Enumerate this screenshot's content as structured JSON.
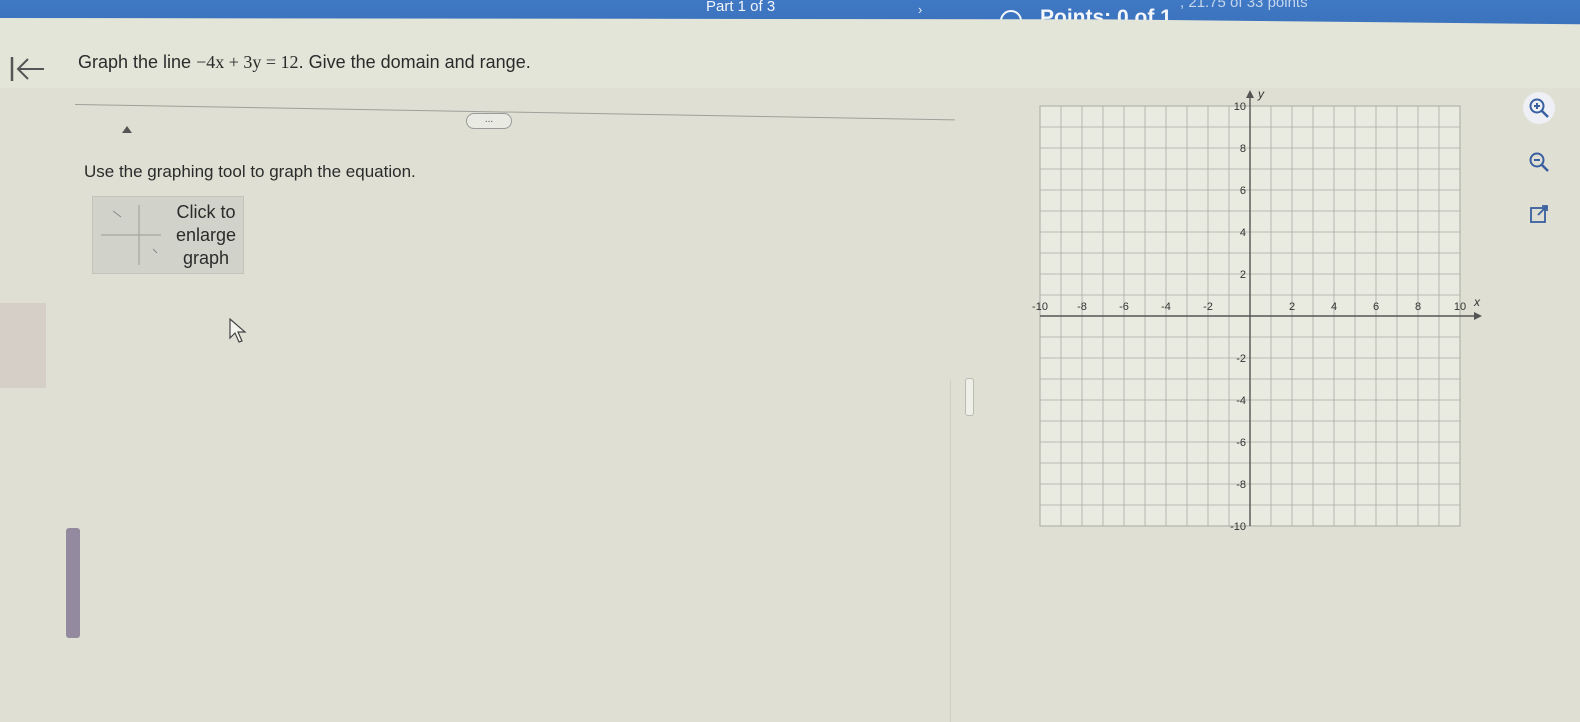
{
  "header": {
    "part": "Part 1 of 3",
    "score_partial": ", 21.75 of 33 points",
    "points": "Points: 0 of 1"
  },
  "question": {
    "prefix": "Graph the line",
    "equation": "−4x + 3y = 12",
    "suffix": ". Give the domain and range."
  },
  "more_button": "...",
  "instruction": "Use the graphing tool to graph the equation.",
  "enlarge_button": "Click to\nenlarge\ngraph",
  "graph": {
    "x_label": "x",
    "y_label": "y",
    "x_ticks": [
      "-10",
      "-8",
      "-6",
      "-4",
      "-2",
      "2",
      "4",
      "6",
      "8",
      "10"
    ],
    "y_ticks": [
      "10",
      "8",
      "6",
      "4",
      "2",
      "-2",
      "-4",
      "-6",
      "-8",
      "-10"
    ],
    "x_range": [
      -10,
      10
    ],
    "y_range": [
      -10,
      10
    ],
    "grid": true
  },
  "tools": {
    "zoom_in": "zoom-in-icon",
    "zoom_out": "zoom-out-icon",
    "expand": "expand-icon"
  },
  "colors": {
    "header": "#3a6fb8",
    "background": "#dfe0d3",
    "grid": "#a9aba4"
  }
}
